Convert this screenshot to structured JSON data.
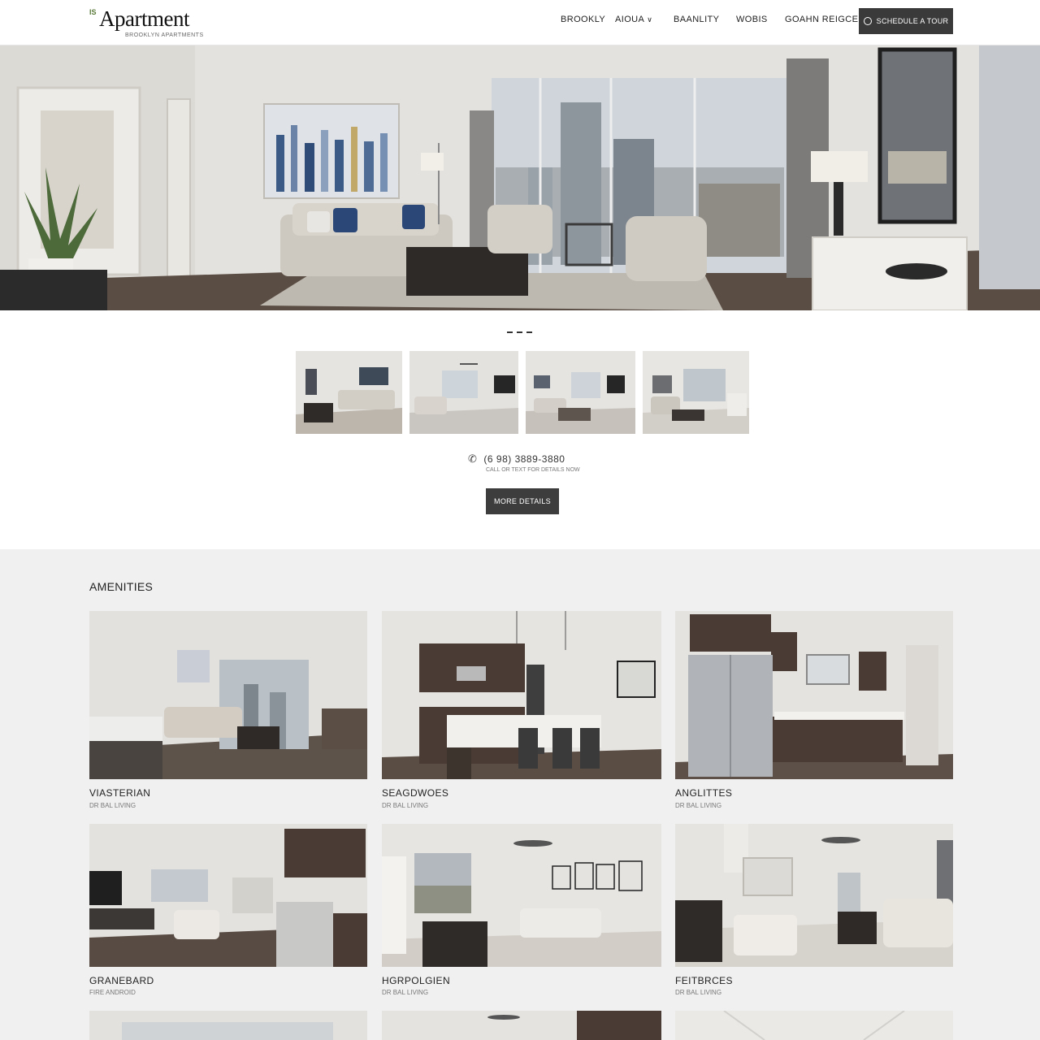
{
  "header": {
    "logo_mark": "IS",
    "logo_text": "Apartment",
    "logo_tagline": "BROOKLYN APARTMENTS",
    "nav": [
      "BROOKLY",
      "AIOUA",
      "BAANLITY",
      "WOBIS",
      "GOAHN REIGCE"
    ],
    "cta_label": "SCHEDULE A TOUR"
  },
  "carousel": {
    "dot_count": 3
  },
  "contact": {
    "phone": "(6 9‌8) 3889-3880",
    "phone_sub": "CALL OR TEXT FOR DETAILS NOW",
    "button_label": "MORE DETAILS"
  },
  "amenities": {
    "title": "AMENITIES",
    "cards": [
      {
        "title": "VIASTERIAN",
        "subtitle": "DR BAL LIVING"
      },
      {
        "title": "SEAGDWOES",
        "subtitle": "DR BAL LIVING"
      },
      {
        "title": "ANGLITTES",
        "subtitle": "DR BAL LIVING"
      },
      {
        "title": "GRANEBARD",
        "subtitle": "FIRE ANDROID"
      },
      {
        "title": "HGRPOLGIEN",
        "subtitle": "DR BAL LIVING"
      },
      {
        "title": "FEITBRCES",
        "subtitle": "DR BAL LIVING"
      }
    ]
  },
  "colors": {
    "accent_dark": "#3a3a3a",
    "section_bg": "#f0f0f0",
    "wall": "#e7e5e1",
    "floor": "#5a4d44",
    "cabinet": "#4a3c34"
  }
}
